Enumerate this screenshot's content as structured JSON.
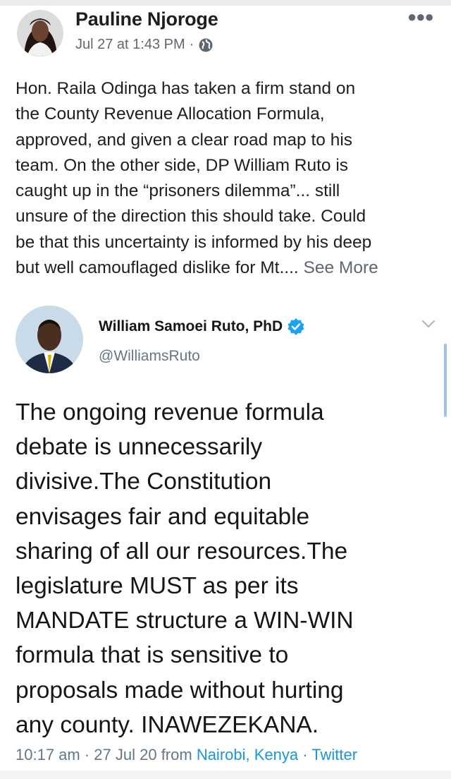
{
  "facebook_post": {
    "author": "Pauline Njoroge",
    "timestamp": "Jul 27 at 1:43 PM",
    "separator": "·",
    "privacy_icon": "globe-icon",
    "menu_icon": "more-options-icon",
    "body_lines": [
      "Hon. Raila Odinga has taken a firm stand on",
      "the County Revenue Allocation Formula,",
      "approved, and given a clear road map to his",
      "team. On the other side, DP William Ruto is",
      "caught up in the “prisoners dilemma”... still",
      "unsure of the direction this should take. Could",
      "be that this uncertainty is informed by his deep",
      "but well camouflaged dislike for Mt.... "
    ],
    "see_more": "See More"
  },
  "tweet": {
    "name": "William Samoei Ruto, PhD",
    "handle": "@WilliamsRuto",
    "verified": true,
    "body_lines": [
      "The ongoing revenue formula",
      "debate is unnecessarily",
      "divisive.The Constitution",
      "envisages fair and equitable",
      "sharing of all our resources.The",
      "legislature MUST as per its",
      "MANDATE structure a WIN-WIN",
      "formula that is sensitive to",
      "proposals made without hurting",
      "any county. INAWEZEKANA."
    ],
    "footer": {
      "time": "10:17 am",
      "sep1": " · ",
      "date": "27 Jul 20 from ",
      "location": "Nairobi, Kenya",
      "sep2": " · ",
      "source": "Twitter"
    }
  },
  "colors": {
    "fb_text": "#1c1e21",
    "fb_meta": "#606770",
    "tw_text": "#14171a",
    "tw_meta": "#657786",
    "tw_link": "#1b95e0",
    "verified": "#1da1f2"
  }
}
